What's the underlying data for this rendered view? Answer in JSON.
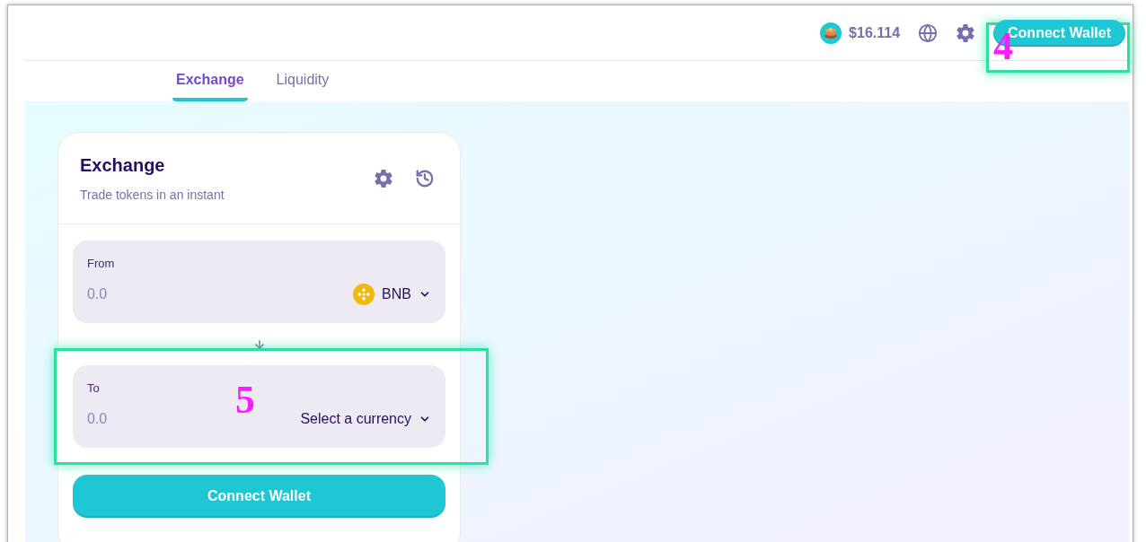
{
  "header": {
    "price": "$16.114",
    "connect_button": "Connect Wallet"
  },
  "tabs": [
    {
      "label": "Exchange",
      "selected": true
    },
    {
      "label": "Liquidity",
      "selected": false
    }
  ],
  "card": {
    "title": "Exchange",
    "subtitle": "Trade tokens in an instant",
    "inputs": [
      {
        "label": "From",
        "placeholder": "0.0",
        "currency": "BNB",
        "kind": "token"
      },
      {
        "label": "To",
        "placeholder": "0.0",
        "currency": "Select a currency",
        "kind": "select"
      }
    ],
    "button": "Connect Wallet"
  },
  "annotations": [
    {
      "number": "4"
    },
    {
      "number": "5"
    }
  ]
}
